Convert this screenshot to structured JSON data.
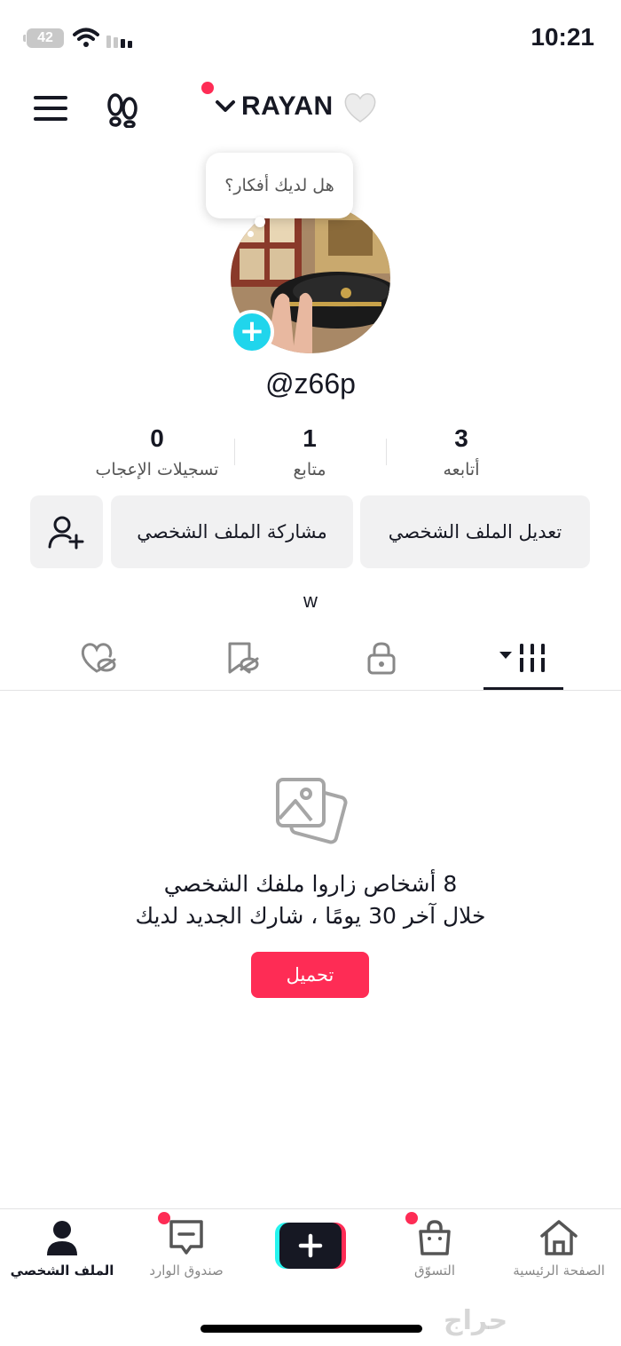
{
  "status_bar": {
    "time": "10:21",
    "battery": "42"
  },
  "header": {
    "username": "RAYAN",
    "chevron": "chevron-down-icon",
    "heart_emoji": "🤍"
  },
  "profile": {
    "bubble_text": "هل لديك أفكار؟",
    "handle": "@z66p",
    "bio": "w",
    "stats": [
      {
        "value": "3",
        "label": "أتابعه"
      },
      {
        "value": "1",
        "label": "متابع"
      },
      {
        "value": "0",
        "label": "تسجيلات الإعجاب"
      }
    ],
    "buttons": {
      "edit": "تعديل الملف الشخصي",
      "share": "مشاركة الملف الشخصي"
    }
  },
  "tabs": [
    {
      "icon": "videos-grid-icon",
      "active": true
    },
    {
      "icon": "lock-icon",
      "active": false
    },
    {
      "icon": "bookmark-hidden-icon",
      "active": false
    },
    {
      "icon": "liked-hidden-icon",
      "active": false
    }
  ],
  "empty_state": {
    "line1": "8 أشخاص زاروا ملفك الشخصي",
    "line2": "خلال آخر 30 يومًا ، شارك الجديد لديك",
    "button": "تحميل"
  },
  "bottom_nav": [
    {
      "label": "الصفحة الرئيسية",
      "icon": "home-icon",
      "active": false
    },
    {
      "label": "التسوّق",
      "icon": "shop-icon",
      "active": false
    },
    {
      "label": "",
      "icon": "create-plus-icon",
      "active": false
    },
    {
      "label": "صندوق الوارد",
      "icon": "inbox-icon",
      "active": false
    },
    {
      "label": "الملف الشخصي",
      "icon": "profile-icon",
      "active": true
    }
  ],
  "watermark": "حراج",
  "colors": {
    "accent": "#fe2c55",
    "teal": "#20d5ec",
    "text": "#161823"
  }
}
